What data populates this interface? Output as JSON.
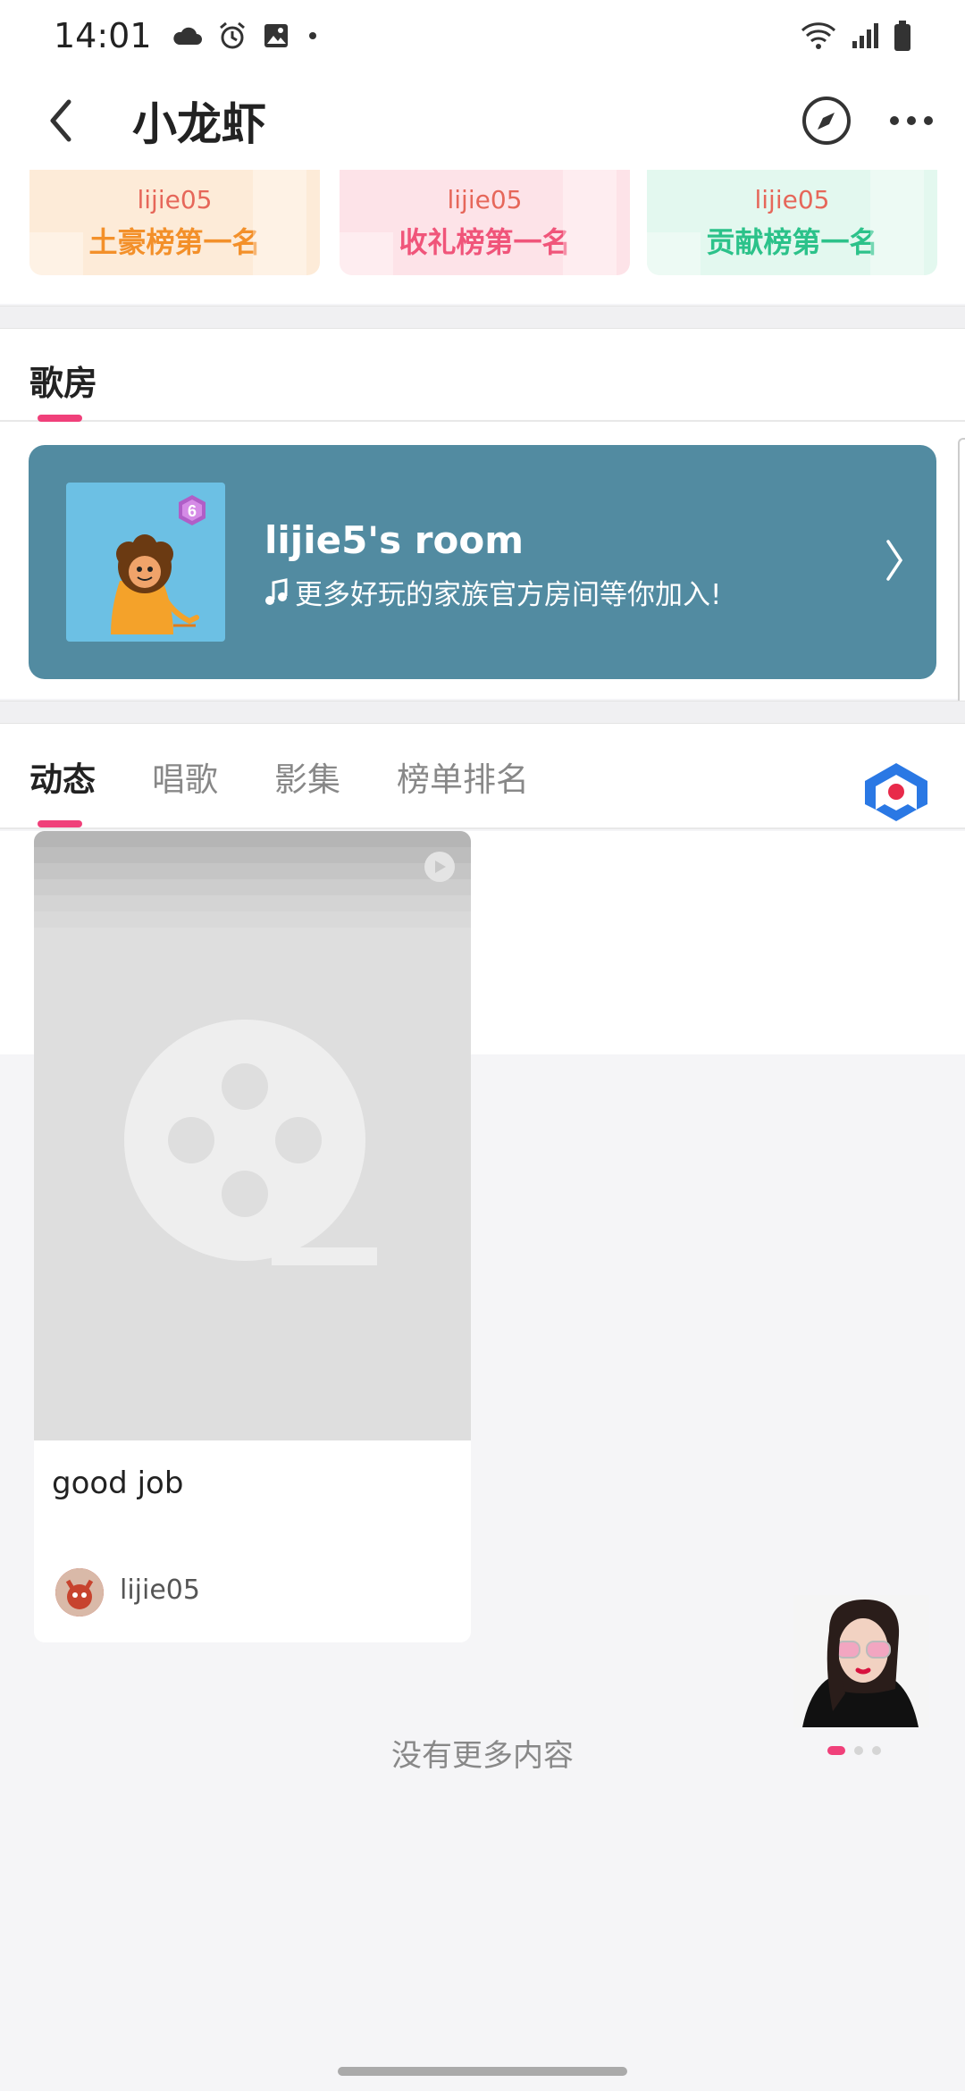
{
  "status_bar": {
    "time": "14:01"
  },
  "header": {
    "title": "小龙虾"
  },
  "rank_cards": [
    {
      "name": "lijie05",
      "title": "土豪榜第一名"
    },
    {
      "name": "lijie05",
      "title": "收礼榜第一名"
    },
    {
      "name": "lijie05",
      "title": "贡献榜第一名"
    }
  ],
  "room_section": {
    "label": "歌房",
    "room": {
      "name": "lijie5's room",
      "desc": "更多好玩的家族官方房间等你加入!",
      "badge": "6"
    }
  },
  "tabs": [
    {
      "label": "动态",
      "active": true
    },
    {
      "label": "唱歌",
      "active": false
    },
    {
      "label": "影集",
      "active": false
    },
    {
      "label": "榜单排名",
      "active": false
    }
  ],
  "post": {
    "caption": "good job",
    "user": "lijie05"
  },
  "ad": {
    "active_index": 0,
    "count": 3
  },
  "feed_footer": "没有更多内容",
  "colors": {
    "accent": "#f0407a",
    "banner": "#528ba1"
  }
}
